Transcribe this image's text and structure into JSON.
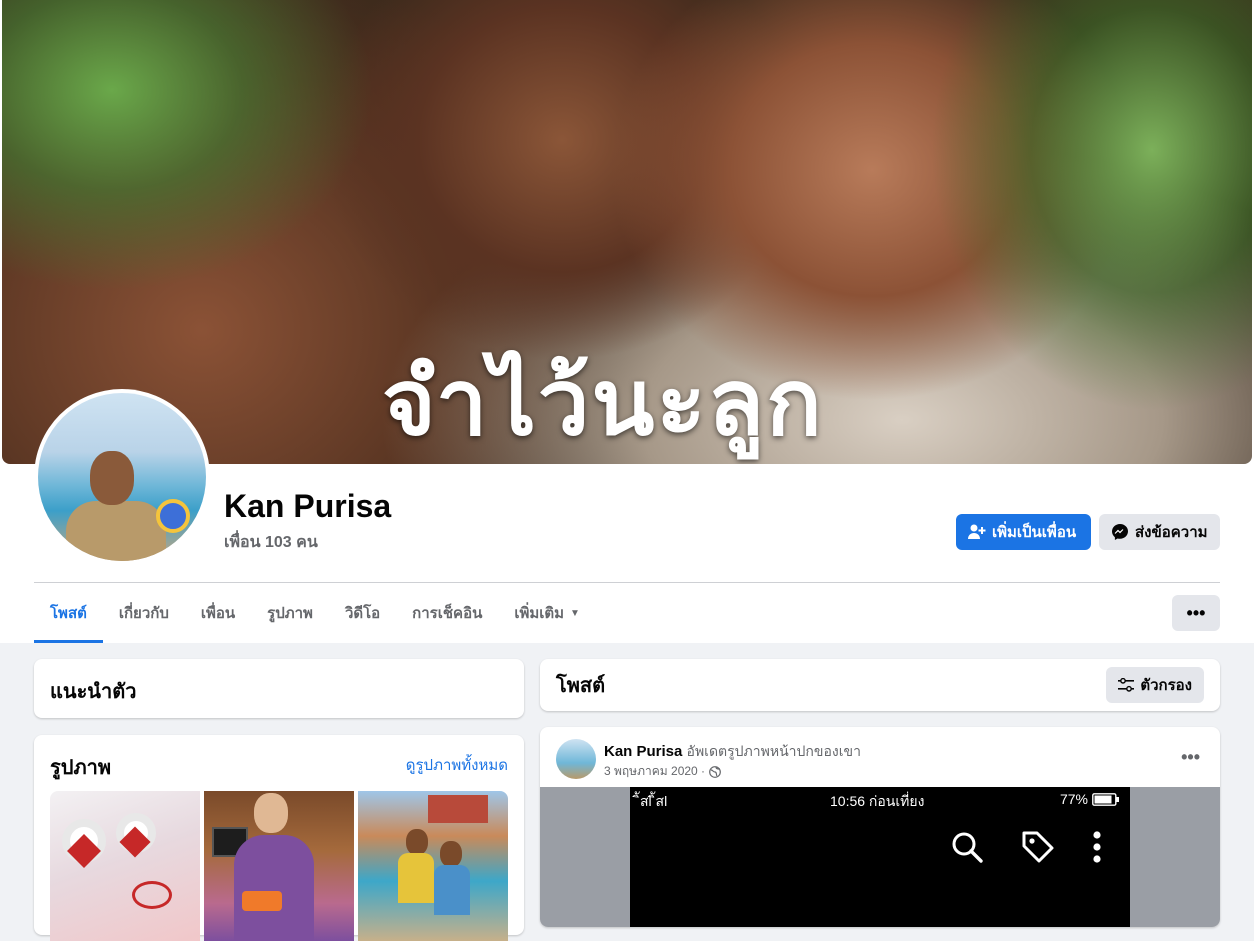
{
  "cover": {
    "text": "จำไว้นะลูก"
  },
  "profile": {
    "name": "Kan Purisa",
    "friends": "เพื่อน 103 คน"
  },
  "actions": {
    "add_friend": "เพิ่มเป็นเพื่อน",
    "message": "ส่งข้อความ"
  },
  "tabs": [
    "โพสต์",
    "เกี่ยวกับ",
    "เพื่อน",
    "รูปภาพ",
    "วิดีโอ",
    "การเช็คอิน",
    "เพิ่มเติม"
  ],
  "more_label": "•••",
  "intro": {
    "title": "แนะนำตัว"
  },
  "photos": {
    "title": "รูปภาพ",
    "see_all": "ดูรูปภาพทั้งหมด"
  },
  "posts": {
    "title": "โพสต์",
    "filter": "ตัวกรอง"
  },
  "post": {
    "author": "Kan Purisa",
    "action": "อัพเดตรูปภาพหน้าปกของเขา",
    "date": "3 พฤษภาคม 2020 ·",
    "menu": "•••",
    "screen": {
      "signal": "ิัสl ิัสl",
      "time": "10:56 ก่อนเที่ยง",
      "battery": "77%"
    }
  },
  "colors": {
    "accent": "#1b74e4",
    "background": "#f0f2f5"
  }
}
